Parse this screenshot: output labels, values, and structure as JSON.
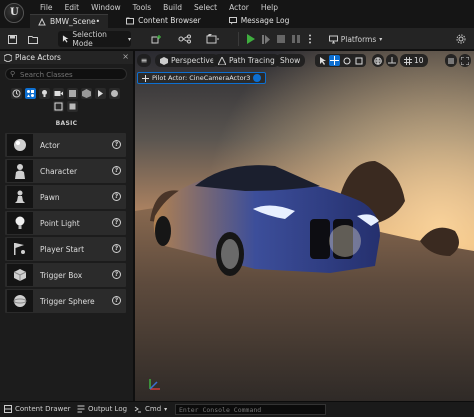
{
  "app": {
    "logo": "U"
  },
  "menu": [
    "File",
    "Edit",
    "Window",
    "Tools",
    "Build",
    "Select",
    "Actor",
    "Help"
  ],
  "tabs": [
    {
      "label": "BMW_Scene•",
      "icon": "level-icon"
    },
    {
      "label": "Content Browser",
      "icon": "content-browser-icon"
    },
    {
      "label": "Message Log",
      "icon": "message-log-icon"
    }
  ],
  "toolbar": {
    "selection_mode": "Selection Mode",
    "platforms": "Platforms"
  },
  "place_actors": {
    "title": "Place Actors",
    "search_placeholder": "Search Classes",
    "category_label": "BASIC",
    "items": [
      {
        "label": "Actor",
        "icon": "sphere-icon"
      },
      {
        "label": "Character",
        "icon": "character-icon"
      },
      {
        "label": "Pawn",
        "icon": "pawn-icon"
      },
      {
        "label": "Point Light",
        "icon": "lightbulb-icon"
      },
      {
        "label": "Player Start",
        "icon": "player-start-icon"
      },
      {
        "label": "Trigger Box",
        "icon": "trigger-box-icon"
      },
      {
        "label": "Trigger Sphere",
        "icon": "trigger-sphere-icon"
      }
    ],
    "help": "?"
  },
  "viewport": {
    "perspective": "Perspective",
    "path_tracing": "Path Tracing",
    "show": "Show",
    "grid_value": "10",
    "pilot_label": "Pilot Actor: CineCameraActor3"
  },
  "bottom": {
    "content_drawer": "Content Drawer",
    "output_log": "Output Log",
    "cmd": "Cmd",
    "console_placeholder": "Enter Console Command"
  },
  "colors": {
    "accent": "#0d6fd1",
    "play": "#3fae3f",
    "car": "#2a3f8a"
  }
}
